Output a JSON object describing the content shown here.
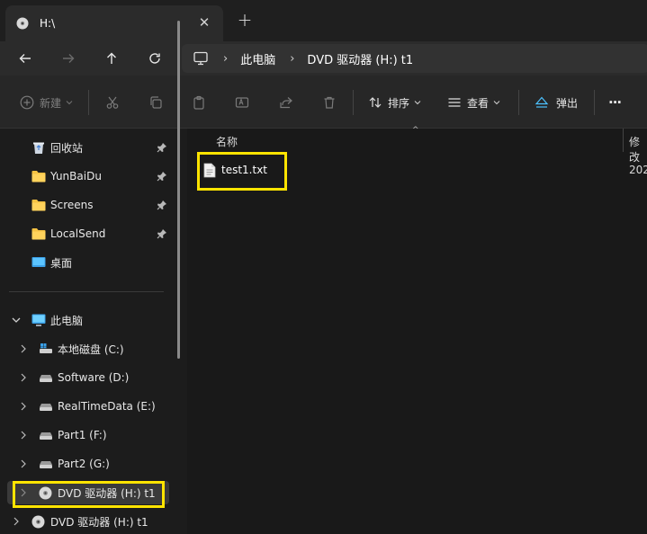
{
  "window": {
    "tab_title": "H:\\",
    "close_symbol": "✕",
    "new_tab_symbol": "+"
  },
  "address_bar": {
    "separator": "›",
    "breadcrumbs": [
      "此电脑",
      "DVD 驱动器 (H:) t1"
    ]
  },
  "toolbar": {
    "new_label": "新建",
    "sort_label": "排序",
    "view_label": "查看",
    "eject_label": "弹出",
    "more_label": "···"
  },
  "sidebar": {
    "quick_access": [
      {
        "label": "回收站",
        "icon": "recycle-bin-icon",
        "pinned": true
      },
      {
        "label": "YunBaiDu",
        "icon": "folder-icon",
        "pinned": true
      },
      {
        "label": "Screens",
        "icon": "folder-icon",
        "pinned": true
      },
      {
        "label": "LocalSend",
        "icon": "folder-icon",
        "pinned": true
      },
      {
        "label": "桌面",
        "icon": "desktop-icon",
        "pinned": false
      }
    ],
    "this_pc": {
      "label": "此电脑",
      "drives": [
        {
          "label": "本地磁盘 (C:)",
          "icon": "windows-drive-icon"
        },
        {
          "label": "Software (D:)",
          "icon": "drive-icon"
        },
        {
          "label": "RealTimeData (E:)",
          "icon": "drive-icon"
        },
        {
          "label": "Part1 (F:)",
          "icon": "drive-icon"
        },
        {
          "label": "Part2 (G:)",
          "icon": "drive-icon"
        },
        {
          "label": "DVD 驱动器 (H:) t1",
          "icon": "dvd-icon",
          "selected": true
        }
      ]
    },
    "bottom_item": {
      "label": "DVD 驱动器 (H:) t1",
      "icon": "dvd-icon"
    }
  },
  "content": {
    "columns": {
      "name": "名称",
      "modified": "修改"
    },
    "files": [
      {
        "name": "test1.txt",
        "modified": "202"
      }
    ]
  },
  "colors": {
    "highlight": "#ffe400",
    "folder": "#f5c243",
    "accent": "#4cc2ff"
  }
}
